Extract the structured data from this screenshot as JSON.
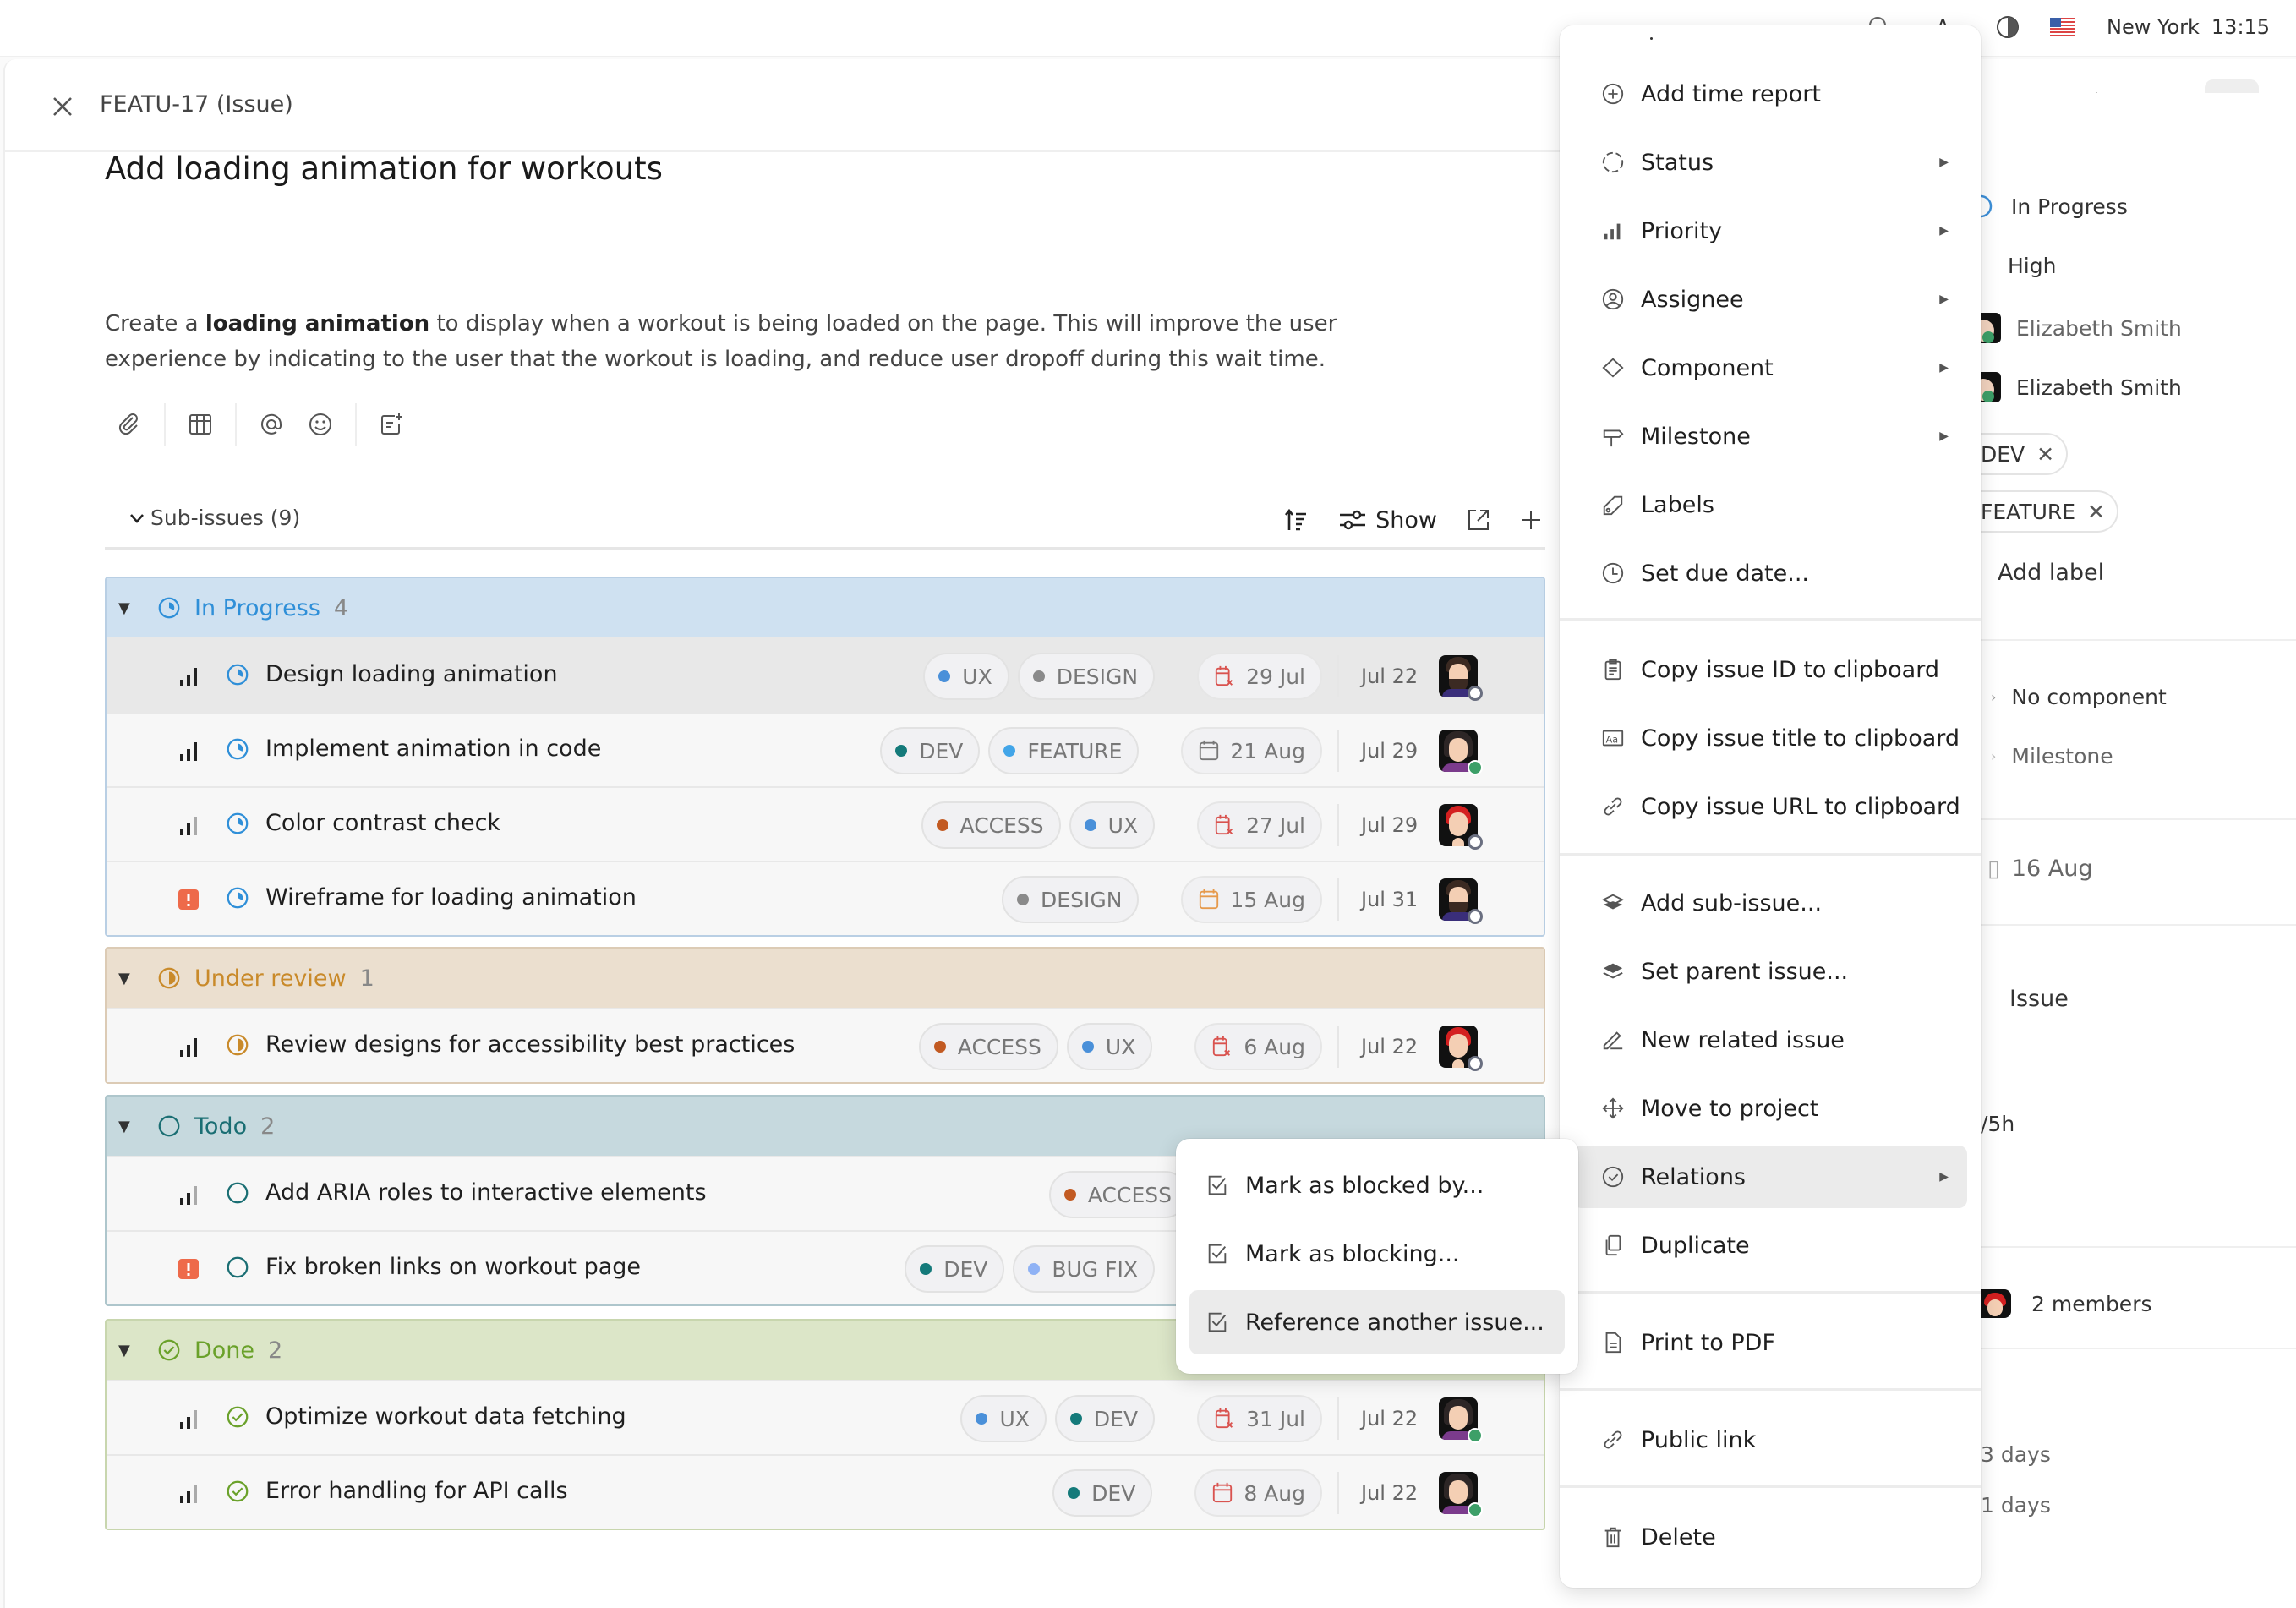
{
  "topbar": {
    "city": "New York",
    "time": "13:15",
    "icons": [
      "search-icon",
      "font-size-icon",
      "contrast-icon",
      "us-flag-icon"
    ]
  },
  "issue": {
    "id_label": "FEATU-17 (Issue)",
    "title": "Add loading animation for workouts",
    "description": {
      "prefix": "Create a ",
      "bold": "loading animation",
      "suffix": " to display when a workout is being loaded on the page. This will improve the user experience by indicating to the user that the workout is loading, and reduce user dropoff during this wait time."
    }
  },
  "header_icons": [
    "more-icon",
    "link-icon",
    "gear-icon",
    "layout-icon",
    "sidebar-toggle-icon"
  ],
  "editor_tools": [
    "attach-icon",
    "table-icon",
    "mention-icon",
    "emoji-icon",
    "add-note-icon"
  ],
  "sub_issues": {
    "label": "Sub-issues (9)",
    "show_label": "Show",
    "groups": [
      {
        "name": "In Progress",
        "count": "4",
        "color": "#2f8fd8",
        "bg": "#cfe1f1",
        "border": "#b9cfe4",
        "rows": [
          {
            "priority": "high",
            "title": "Design loading animation",
            "tags": [
              {
                "label": "UX",
                "color": "#4a90d9"
              },
              {
                "label": "DESIGN",
                "color": "#8a8a8a"
              }
            ],
            "due": "29 Jul",
            "due_state": "overdue",
            "created": "Jul 22",
            "avatar": "man-beard",
            "presence": "off",
            "hover": true
          },
          {
            "priority": "high",
            "title": "Implement animation in code",
            "tags": [
              {
                "label": "DEV",
                "color": "#147a7a"
              },
              {
                "label": "FEATURE",
                "color": "#42a5e8"
              }
            ],
            "due": "21 Aug",
            "due_state": "normal",
            "created": "Jul 29",
            "avatar": "woman-dark",
            "presence": "on"
          },
          {
            "priority": "medium",
            "title": "Color contrast check",
            "tags": [
              {
                "label": "ACCESS",
                "color": "#c25a22"
              },
              {
                "label": "UX",
                "color": "#4a90d9"
              }
            ],
            "due": "27 Jul",
            "due_state": "overdue",
            "created": "Jul 29",
            "avatar": "woman-red",
            "presence": "off"
          },
          {
            "priority": "urgent",
            "title": "Wireframe for loading animation",
            "tags": [
              {
                "label": "DESIGN",
                "color": "#8a8a8a"
              }
            ],
            "due": "15 Aug",
            "due_state": "soon",
            "created": "Jul 31",
            "avatar": "man-beard",
            "presence": "off"
          }
        ]
      },
      {
        "name": "Under review",
        "count": "1",
        "color": "#c98a2a",
        "bg": "#ebdfcf",
        "border": "#dccbb5",
        "rows": [
          {
            "priority": "high",
            "title": "Review designs for accessibility best practices",
            "tags": [
              {
                "label": "ACCESS",
                "color": "#c25a22"
              },
              {
                "label": "UX",
                "color": "#4a90d9"
              }
            ],
            "due": "6 Aug",
            "due_state": "overdue",
            "created": "Jul 22",
            "avatar": "woman-red",
            "presence": "off"
          }
        ]
      },
      {
        "name": "Todo",
        "count": "2",
        "color": "#1a6e73",
        "bg": "#c6d9de",
        "border": "#aec6cc",
        "rows": [
          {
            "priority": "medium",
            "title": "Add ARIA roles to interactive elements",
            "tags": [
              {
                "label": "ACCESS",
                "color": "#c25a22"
              }
            ],
            "due": "",
            "created": "",
            "avatar": ""
          },
          {
            "priority": "urgent",
            "title": "Fix broken links on workout page",
            "tags": [
              {
                "label": "DEV",
                "color": "#147a7a"
              },
              {
                "label": "BUG FIX",
                "color": "#8fb2f5"
              }
            ],
            "due": "",
            "created": "",
            "avatar": ""
          }
        ]
      },
      {
        "name": "Done",
        "count": "2",
        "color": "#6aa12a",
        "bg": "#dce6c8",
        "border": "#c8d6ae",
        "rows": [
          {
            "priority": "medium",
            "title": "Optimize workout data fetching",
            "tags": [
              {
                "label": "UX",
                "color": "#4a90d9"
              },
              {
                "label": "DEV",
                "color": "#147a7a"
              }
            ],
            "due": "31 Jul",
            "due_state": "overdue",
            "created": "Jul 22",
            "avatar": "woman-dark",
            "presence": "on"
          },
          {
            "priority": "medium",
            "title": "Error handling for API calls",
            "tags": [
              {
                "label": "DEV",
                "color": "#147a7a"
              }
            ],
            "due": "8 Aug",
            "due_state": "overdue-plain",
            "created": "Jul 22",
            "avatar": "woman-dark",
            "presence": "on"
          }
        ]
      }
    ]
  },
  "context_menu": {
    "items": [
      {
        "label": "Add time report",
        "icon": "plus-circle-icon"
      },
      {
        "label": "Status",
        "icon": "status-dashed-circle-icon",
        "submenu": true
      },
      {
        "label": "Priority",
        "icon": "priority-bars-icon",
        "submenu": true
      },
      {
        "label": "Assignee",
        "icon": "user-circle-icon",
        "submenu": true
      },
      {
        "label": "Component",
        "icon": "diamond-icon",
        "submenu": true
      },
      {
        "label": "Milestone",
        "icon": "signpost-icon",
        "submenu": true
      },
      {
        "label": "Labels",
        "icon": "tag-icon"
      },
      {
        "label": "Set due date...",
        "icon": "clock-icon"
      },
      {
        "label": "Copy issue ID to clipboard",
        "icon": "clipboard-icon"
      },
      {
        "label": "Copy issue title to clipboard",
        "icon": "text-aa-icon"
      },
      {
        "label": "Copy issue URL to clipboard",
        "icon": "link-icon"
      },
      {
        "label": "Add sub-issue...",
        "icon": "layers-add-icon"
      },
      {
        "label": "Set parent issue...",
        "icon": "layers-parent-icon"
      },
      {
        "label": "New related issue",
        "icon": "pencil-icon"
      },
      {
        "label": "Move to project",
        "icon": "move-arrows-icon"
      },
      {
        "label": "Relations",
        "icon": "check-circle-icon",
        "submenu": true,
        "active": true
      },
      {
        "label": "Duplicate",
        "icon": "duplicate-icon"
      },
      {
        "label": "Print to PDF",
        "icon": "document-icon"
      },
      {
        "label": "Public link",
        "icon": "link-icon"
      },
      {
        "label": "Delete",
        "icon": "trash-icon"
      }
    ]
  },
  "relations_submenu": {
    "items": [
      {
        "label": "Mark as blocked by..."
      },
      {
        "label": "Mark as blocking..."
      },
      {
        "label": "Reference another issue...",
        "active": true
      }
    ]
  },
  "sidebar": {
    "status": "In Progress",
    "priority": "High",
    "assignee": "Elizabeth Smith",
    "reporter": "Elizabeth Smith",
    "labels": [
      "DEV",
      "FEATURE"
    ],
    "add_label": "Add label",
    "component": "No component",
    "milestone": "Milestone",
    "due_date": "16 Aug",
    "type": "Issue",
    "estimate_partial": "/5h",
    "collaborators": "2 members",
    "age_1": "3 days",
    "age_2": "1 days"
  }
}
